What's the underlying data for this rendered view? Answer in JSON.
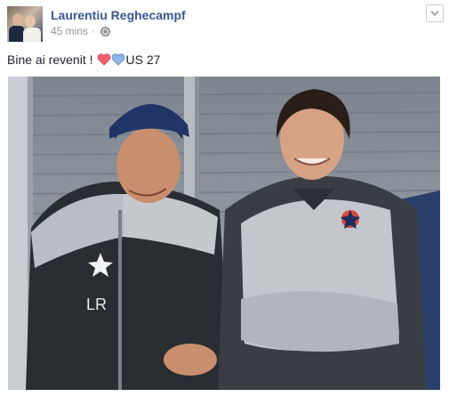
{
  "post": {
    "author": "Laurentiu Reghecampf",
    "time": "45 mins",
    "separator": "·",
    "privacy_icon": "globe-icon",
    "options_icon": "chevron-down-icon",
    "text_before": "Bine ai revenit !",
    "emoji": [
      "red-heart-icon",
      "blue-heart-icon"
    ],
    "text_after": "US 27"
  },
  "colors": {
    "author_link": "#365899",
    "meta_text": "#90949c",
    "body_text": "#1d2129",
    "heart_red": "#f0606e",
    "heart_blue": "#8fb8e8"
  }
}
